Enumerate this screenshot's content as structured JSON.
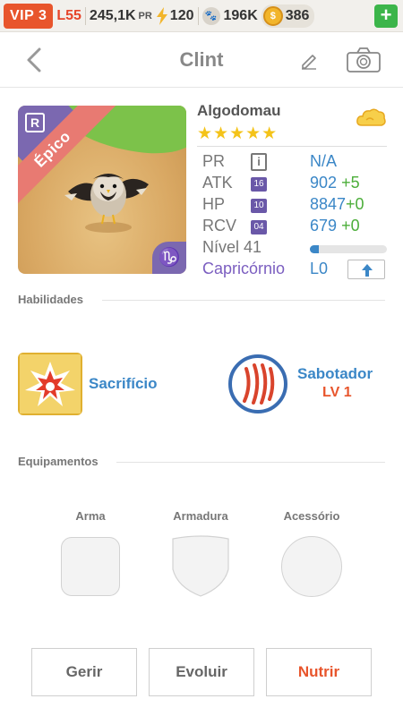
{
  "topbar": {
    "vip": "VIP 3",
    "level": "L55",
    "power": "245,1K",
    "power_unit": "PR",
    "energy": "120",
    "paws": "196K",
    "coins": "386",
    "add": "+"
  },
  "header": {
    "title": "Clint"
  },
  "card": {
    "rarity": "Épico",
    "rank_badge": "R",
    "zodiac_symbol": "♑"
  },
  "pet": {
    "name": "Algodomau",
    "stars": "★★★★★",
    "stats": [
      {
        "label": "PR",
        "badge": "i",
        "value": "N/A",
        "bonus": ""
      },
      {
        "label": "ATK",
        "badge": "16",
        "value": "902",
        "bonus": "+5"
      },
      {
        "label": "HP",
        "badge": "10",
        "value": "8847",
        "bonus": "+0"
      },
      {
        "label": "RCV",
        "badge": "04",
        "value": "679",
        "bonus": "+0"
      }
    ],
    "level_label": "Nível 41",
    "level_progress": 0.12,
    "zodiac": "Capricórnio",
    "zodiac_level": "L0"
  },
  "sections": {
    "skills": "Habilidades",
    "equipment": "Equipamentos"
  },
  "skills": [
    {
      "name": "Sacrifício"
    },
    {
      "name": "Sabotador",
      "level": "LV 1"
    }
  ],
  "equipment": [
    {
      "label": "Arma"
    },
    {
      "label": "Armadura"
    },
    {
      "label": "Acessório"
    }
  ],
  "buttons": {
    "manage": "Gerir",
    "evolve": "Evoluir",
    "feed": "Nutrir"
  },
  "colors": {
    "accent_blue": "#3b87c7",
    "vip_red": "#e8552c",
    "bonus_green": "#4cae3a",
    "zodiac_purple": "#7b5ec0"
  }
}
